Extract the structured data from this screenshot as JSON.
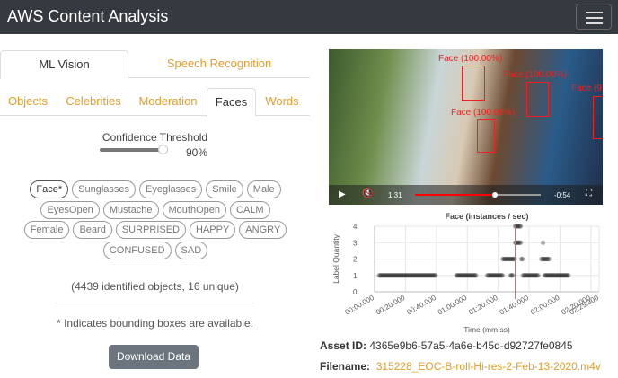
{
  "app": {
    "title": "AWS Content Analysis"
  },
  "tabs_primary": [
    {
      "label": "ML Vision",
      "active": true
    },
    {
      "label": "Speech Recognition",
      "active": false
    }
  ],
  "tabs_secondary": [
    {
      "label": "Objects"
    },
    {
      "label": "Celebrities"
    },
    {
      "label": "Moderation"
    },
    {
      "label": "Faces",
      "active": true
    },
    {
      "label": "Words"
    }
  ],
  "confidence": {
    "label": "Confidence Threshold",
    "value_label": "90%",
    "value": 90
  },
  "labels": [
    "Face*",
    "Sunglasses",
    "Eyeglasses",
    "Smile",
    "Male",
    "EyesOpen",
    "Mustache",
    "MouthOpen",
    "CALM",
    "Female",
    "Beard",
    "SURPRISED",
    "HAPPY",
    "ANGRY",
    "CONFUSED",
    "SAD"
  ],
  "summary": "(4439 identified objects, 16 unique)",
  "note": "* Indicates bounding boxes are available.",
  "download_label": "Download Data",
  "video": {
    "current_time": "1:31",
    "remaining": "-0:54",
    "progress": 0.63,
    "boxes": [
      {
        "label": "Face (100.00%)"
      },
      {
        "label": "Face (100.00%)"
      },
      {
        "label": "Face (100.00%)"
      },
      {
        "label": "Face (9"
      }
    ]
  },
  "chart_data": {
    "type": "scatter",
    "title": "Face (instances / sec)",
    "xlabel": "Time (mm:ss)",
    "ylabel": "Label Quantity",
    "xlim": [
      0,
      145.3
    ],
    "ylim": [
      0,
      4
    ],
    "yticks": [
      "0",
      "1",
      "2",
      "3",
      "4"
    ],
    "xticks": [
      {
        "v": 0,
        "l": "00:00.000"
      },
      {
        "v": 20,
        "l": "00:20.000"
      },
      {
        "v": 40,
        "l": "00:40.000"
      },
      {
        "v": 60,
        "l": "01:00.000"
      },
      {
        "v": 80,
        "l": "01:20.000"
      },
      {
        "v": 100,
        "l": "01:40.000"
      },
      {
        "v": 120,
        "l": "02:00.000"
      },
      {
        "v": 140,
        "l": "02:20.000"
      },
      {
        "v": 145.3,
        "l": "02:25.300"
      }
    ],
    "marker_time": 91,
    "segments": [
      [
        3,
        40,
        1
      ],
      [
        53,
        66,
        1
      ],
      [
        73,
        83,
        1
      ],
      [
        88,
        90,
        1
      ],
      [
        96,
        106,
        1
      ],
      [
        110,
        126,
        1
      ],
      [
        83,
        91,
        2
      ],
      [
        95,
        96,
        2
      ],
      [
        108,
        113,
        2
      ],
      [
        91,
        95,
        3
      ],
      [
        109,
        109,
        3
      ],
      [
        91,
        95,
        4
      ]
    ]
  },
  "asset": {
    "id_label": "Asset ID:",
    "id": "4365e9b6-57a5-4a6e-b45d-d92727fe0845",
    "filename_label": "Filename:",
    "filename": "315228_EOC-B-roll-Hi-res-2-Feb-13-2020.m4v"
  }
}
